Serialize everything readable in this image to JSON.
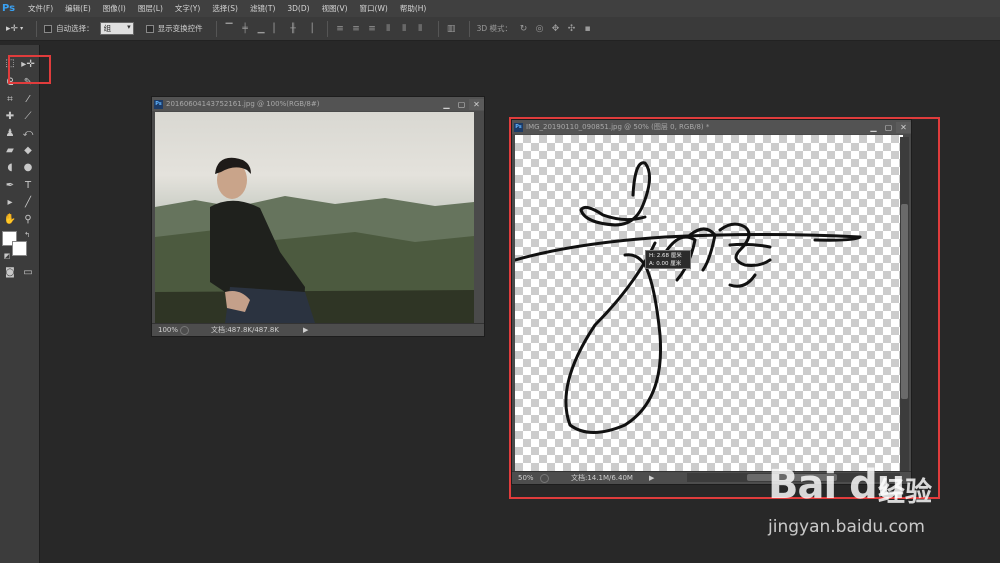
{
  "menu": [
    "文件(F)",
    "编辑(E)",
    "图像(I)",
    "图层(L)",
    "文字(Y)",
    "选择(S)",
    "滤镜(T)",
    "3D(D)",
    "视图(V)",
    "窗口(W)",
    "帮助(H)"
  ],
  "app_logo": "Ps",
  "options": {
    "auto_select_label": "自动选择：",
    "auto_select_value": "组",
    "show_transform_label": "显示变换控件",
    "mode_3d_label": "3D 模式："
  },
  "photo_window": {
    "title": "20160604143752161.jpg @ 100%(RGB/8#)",
    "zoom": "100%",
    "doc_info": "文档:487.8K/487.8K"
  },
  "signature_window": {
    "title": "IMG_20190110_090851.jpg @ 50% (图层 0, RGB/8) *",
    "zoom": "50%",
    "doc_info": "文档:14.1M/6.40M"
  },
  "tooltip": {
    "line1": "H: 2.68 厘米",
    "line2": "A: 0.00 厘米"
  },
  "watermark": {
    "logo": "Bai du",
    "brand_cn": "经验",
    "url": "jingyan.baidu.com"
  },
  "colors": {
    "highlight": "#e03c3c",
    "ps_blue": "#3aa0f0"
  }
}
